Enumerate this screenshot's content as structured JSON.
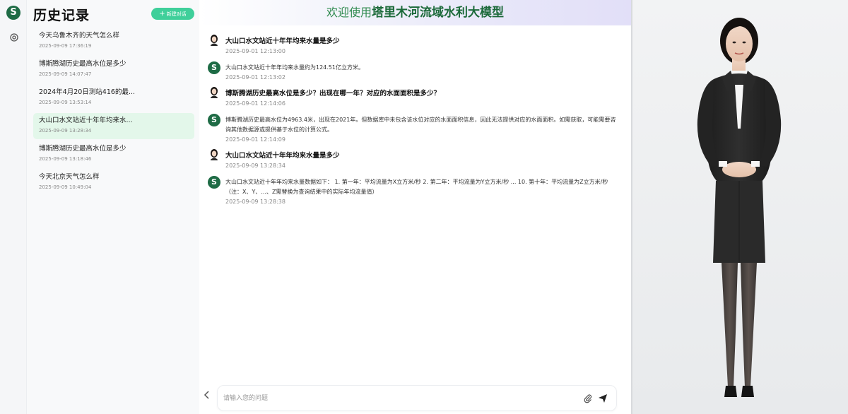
{
  "sidebar": {
    "logo_glyph": "S",
    "title": "历史记录",
    "new_chat_label": "新建对话",
    "icons": {
      "logo": "app-logo",
      "settings": "settings-icon",
      "plus": "plus-icon"
    },
    "items": [
      {
        "question": "今天乌鲁木齐的天气怎么样",
        "time": "2025-09-09 17:36:19"
      },
      {
        "question": "博斯腾湖历史最高水位是多少",
        "time": "2025-09-09 14:07:47"
      },
      {
        "question": "2024年4月20日测站416的最...",
        "time": "2025-09-09 13:53:14"
      },
      {
        "question": "大山口水文站近十年年均来水...",
        "time": "2025-09-09 13:28:34"
      },
      {
        "question": "博斯腾湖历史最高水位是多少",
        "time": "2025-09-09 13:18:46"
      },
      {
        "question": "今天北京天气怎么样",
        "time": "2025-09-09 10:49:04"
      }
    ],
    "active_index": 3
  },
  "banner": {
    "prefix": "欢迎使用",
    "name": "塔里木河流域水利大模型"
  },
  "messages": [
    {
      "role": "user",
      "text": "大山口水文站近十年年均来水量是多少",
      "time": "2025-09-01 12:13:00"
    },
    {
      "role": "bot",
      "text": "大山口水文站近十年年均来水量约为124.51亿立方米。",
      "time": "2025-09-01 12:13:02"
    },
    {
      "role": "user",
      "text": "博斯腾湖历史最高水位是多少？出现在哪一年？对应的水面面积是多少？",
      "time": "2025-09-01 12:14:06"
    },
    {
      "role": "bot",
      "text": "博斯腾湖历史最高水位为4963.4米，出现在2021年。但数据库中未包含该水位对应的水面面积信息，因此无法提供对应的水面面积。如需获取，可能需要咨询其他数据源或提供基于水位的计算公式。",
      "time": "2025-09-01 12:14:09"
    },
    {
      "role": "user",
      "text": "大山口水文站近十年年均来水量是多少",
      "time": "2025-09-09 13:28:34"
    },
    {
      "role": "bot",
      "text": "大山口水文站近十年年均来水量数据如下： 1. 第一年：平均流量为X立方米/秒 2. 第二年：平均流量为Y立方米/秒 ... 10. 第十年：平均流量为Z立方米/秒 （注：X、Y、...、Z需替换为查询结果中的实际年均流量值）",
      "time": "2025-09-09 13:28:38"
    }
  ],
  "composer": {
    "placeholder": "请输入您的问题",
    "icons": {
      "collapse": "chevron-left-icon",
      "attach": "paperclip-icon",
      "send": "send-icon"
    }
  },
  "avatar_panel": {
    "description_icon": "digital-human-avatar"
  },
  "colors": {
    "brand_green": "#1e6b45",
    "new_chat_button": "#3fcf9a",
    "active_item": "#e3f7ea"
  }
}
